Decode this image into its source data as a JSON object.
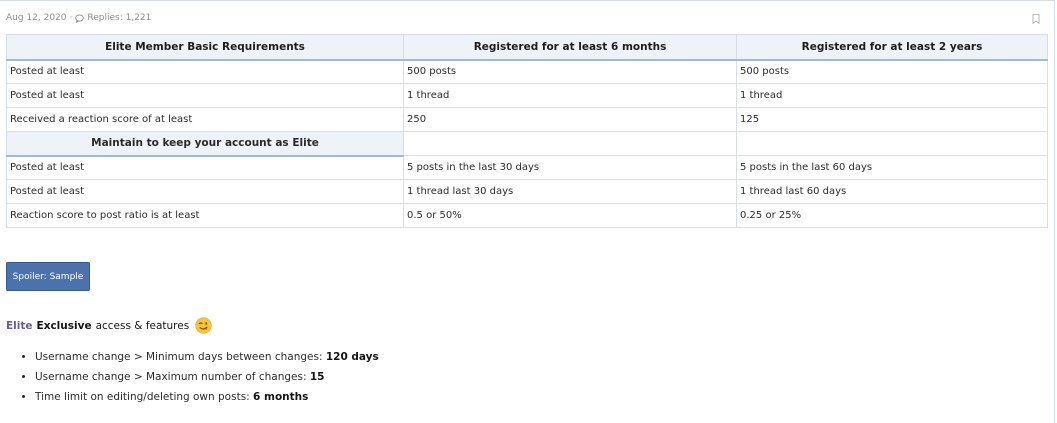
{
  "post_meta": {
    "date": "Aug 12, 2020",
    "separator": "·",
    "replies": "Replies: 1,221"
  },
  "table": {
    "headers": [
      "Elite Member Basic Requirements",
      "Registered for at least 6 months",
      "Registered for at least 2 years"
    ],
    "basic_rows": [
      [
        "Posted at least",
        "500 posts",
        "500 posts"
      ],
      [
        "Posted at least",
        "1 thread",
        "1 thread"
      ],
      [
        "Received a reaction score of at least",
        "250",
        "125"
      ]
    ],
    "maintain_header": "Maintain to keep your account as Elite",
    "maintain_rows": [
      [
        "Posted at least",
        "5 posts in the last 30 days",
        "5 posts in the last 60 days"
      ],
      [
        "Posted at least",
        "1 thread last 30 days",
        "1 thread last 60 days"
      ],
      [
        "Reaction score to post ratio is at least",
        "0.5 or 50%",
        "0.25 or 25%"
      ]
    ]
  },
  "spoiler": {
    "label": "Spoiler: Sample"
  },
  "elite_section": {
    "elite_word": "Elite",
    "exclusive_word": "Exclusive",
    "rest": "access & features",
    "emoji": "winking-face-emoji"
  },
  "features": [
    {
      "text": "Username change > Minimum days between changes: ",
      "value": "120 days"
    },
    {
      "text": "Username change > Maximum number of changes: ",
      "value": "15"
    },
    {
      "text": "Time limit on editing/deleting own posts: ",
      "value": "6 months"
    }
  ],
  "colors": {
    "table_header_bg": "#edf3f9",
    "spoiler_button": "#4b72ad",
    "elite_text": "#6b5f8e"
  }
}
